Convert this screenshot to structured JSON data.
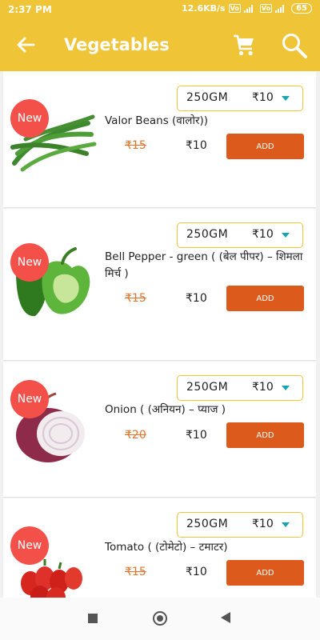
{
  "status_bar": {
    "time": "2:37 PM",
    "network_speed": "12.6KB/s",
    "vo1": "Vo",
    "vo2": "Vo",
    "battery": "65"
  },
  "header": {
    "title": "Vegetables",
    "back_icon": "arrow-back-icon",
    "cart_icon": "cart-icon",
    "search_icon": "search-icon"
  },
  "colors": {
    "accent": "#F0C437",
    "new_badge": "#F4504A",
    "add_button": "#DD5A1D",
    "old_price": "#E2742C",
    "caret": "#19A4B2"
  },
  "products": [
    {
      "badge": "New",
      "weight": "250GM",
      "price": "₹10",
      "name": "Valor Beans  (वालोर))",
      "mrp": "₹15",
      "sale_price": "₹10",
      "add_label": "ADD"
    },
    {
      "badge": "New",
      "weight": "250GM",
      "price": "₹10",
      "name": "Bell Pepper - green ( (बेल पीपर) – शिमला मिर्च )",
      "mrp": "₹15",
      "sale_price": "₹10",
      "add_label": "ADD"
    },
    {
      "badge": "New",
      "weight": "250GM",
      "price": "₹10",
      "name": "Onion ( (अनियन) – प्याज )",
      "mrp": "₹20",
      "sale_price": "₹10",
      "add_label": "ADD"
    },
    {
      "badge": "New",
      "weight": "250GM",
      "price": "₹10",
      "name": "Tomato ( (टोमेटो) – टमाटर)",
      "mrp": "₹15",
      "sale_price": "₹10",
      "add_label": "ADD"
    }
  ],
  "nav": {
    "recents": "recents-square-icon",
    "home": "home-circle-icon",
    "back": "back-triangle-icon"
  }
}
